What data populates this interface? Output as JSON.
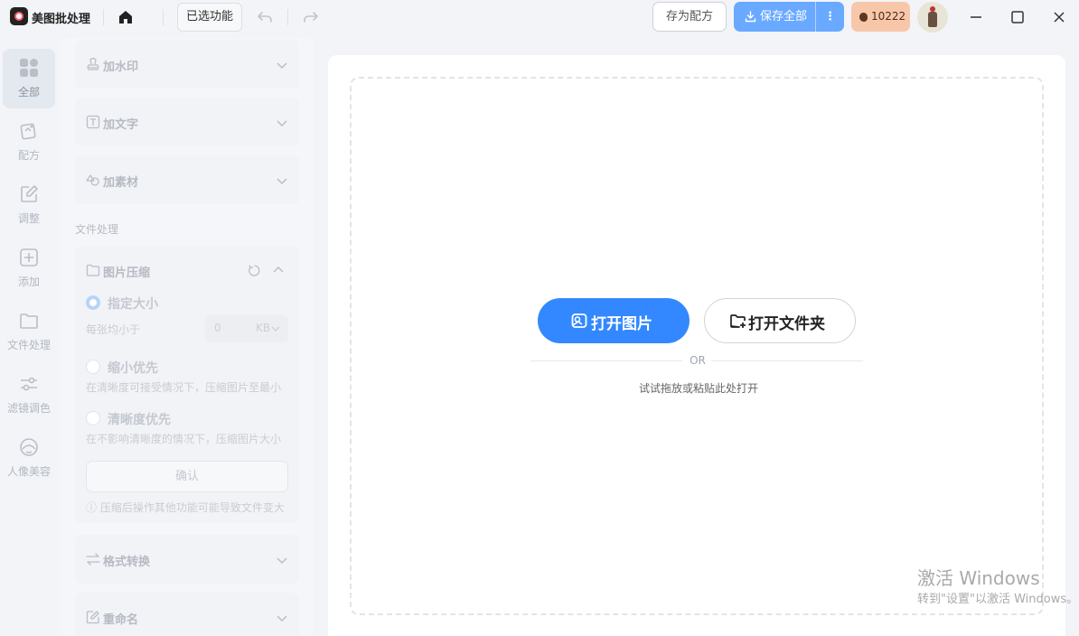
{
  "titlebar": {
    "app_name": "美图批处理",
    "selected_functions": "已选功能",
    "save_recipe": "存为配方",
    "save_all": "保存全部",
    "save_all_more": "⋮",
    "points": "10222"
  },
  "rail": {
    "items": [
      {
        "label": "全部",
        "icon": "grid-icon",
        "active": true
      },
      {
        "label": "配方",
        "icon": "recipe-images-icon"
      },
      {
        "label": "调整",
        "icon": "edit-icon"
      },
      {
        "label": "添加",
        "icon": "add-square-icon"
      },
      {
        "label": "文件处理",
        "icon": "folder-icon"
      },
      {
        "label": "滤镜调色",
        "icon": "sliders-icon"
      },
      {
        "label": "人像美容",
        "icon": "face-icon"
      }
    ]
  },
  "panel": {
    "watermark": "加水印",
    "add_text": "加文字",
    "add_material": "加素材",
    "file_section": "文件处理",
    "compress": {
      "title": "图片压缩",
      "option1_title": "指定大小",
      "option1_desc": "每张均小于",
      "size_value": "0",
      "size_unit": "KB",
      "option2_title": "缩小优先",
      "option2_desc": "在清晰度可接受情况下，压缩图片至最小",
      "option3_title": "清晰度优先",
      "option3_desc": "在不影响清晰度的情况下，压缩图片大小",
      "confirm": "确认",
      "warning": "ⓘ 压缩后操作其他功能可能导致文件变大"
    },
    "format_convert": "格式转换",
    "rename": "重命名"
  },
  "main": {
    "open_image": "打开图片",
    "open_folder": "打开文件夹",
    "or": "OR",
    "hint": "试试拖放或粘贴此处打开"
  },
  "watermark_overlay": {
    "title": "激活 Windows",
    "subtitle": "转到\"设置\"以激活 Windows。"
  },
  "colors": {
    "primary": "#3388ff",
    "save_all_bg": "#69a9ff",
    "points_bg": "#f8c7a9",
    "app_bg": "#f2f4f8"
  }
}
